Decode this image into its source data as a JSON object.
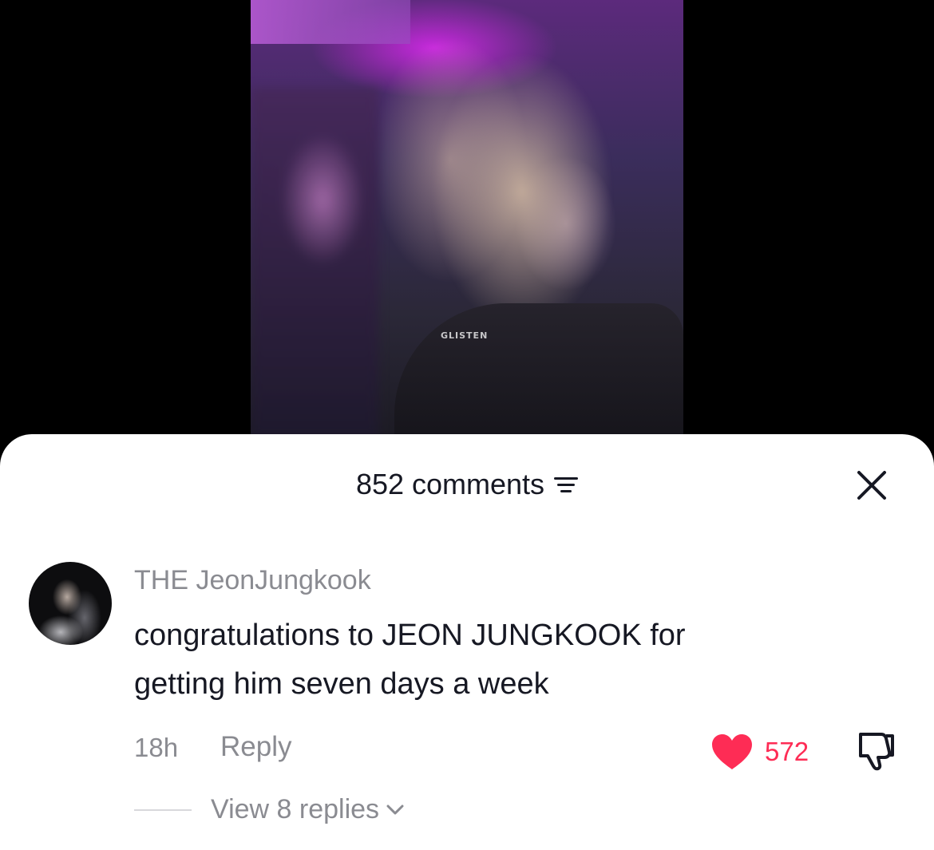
{
  "video": {
    "watermark": "GLISTEN"
  },
  "comments_panel": {
    "title": "852 comments",
    "sort_icon": "sort-lines-icon",
    "close_icon": "close-x-icon"
  },
  "comment": {
    "username": "THE JeonJungkook",
    "text_line1": "congratulations to JEON JUNGKOOK for",
    "text_line2": "getting him seven days a week",
    "timestamp": "18h",
    "reply_label": "Reply",
    "like_count": "572",
    "liked": true,
    "like_color": "#fe2c55",
    "view_replies_label": "View 8 replies"
  }
}
